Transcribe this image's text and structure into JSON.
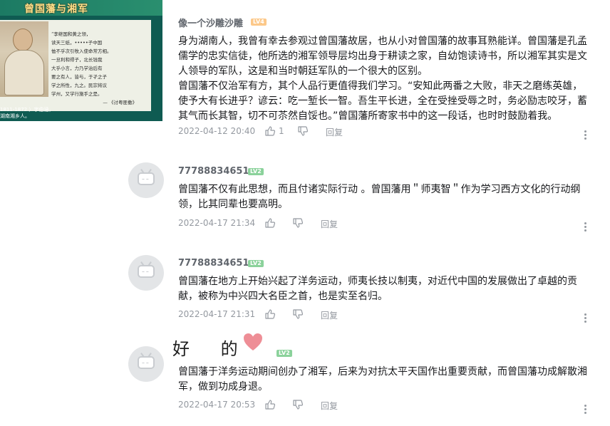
{
  "video": {
    "title": "曾国藩与湘军",
    "poem_lines": [
      "“李继国和黄之领，",
      "读天三纸，•••••子中国",
      "恤不乎次引牧入使命常方相。",
      "一旦利和得子，北长钱我",
      "大乎小言，力乃学治后有",
      "要之有人，皆与，于孑之子",
      "学之所性，九之。民宗将议",
      "学州，又学行施手之是。",
      "— 《讨粤匪檄》"
    ],
    "dates": [
      "1811-1872 ）字伯涵，",
      "湖南湘乡人。"
    ]
  },
  "comments": [
    {
      "username": "像一个沙雕沙雕",
      "level": "LV4",
      "paragraphs": [
        "身为湖南人，我曾有幸去参观过曾国藩故居，也从小对曾国藩的故事耳熟能详。曾国藩是孔孟儒学的忠实信徒，他所选的湘军领导层均出身于耕读之家，自幼饱读诗书，所以湘军其实是文人领导的军队，这是和当时朝廷军队的一个很大的区别。",
        "曾国藩不仅治军有方，其个人品行更值得我们学习。“安知此两番之大败，非天之磨练英雄，使予大有长进乎？谚云：吃一堑长一智。吾生平长进，全在受挫受辱之时，务必励志咬牙，蓄其气而长其智，切不可苶然自馁也。”曾国藩所寄家书中的这一段话，也时时鼓励着我。"
      ],
      "date": "2022-04-12 20:40",
      "likes": "1",
      "reply_label": "回复"
    },
    {
      "username": "77788834651",
      "level": "LV2",
      "paragraphs": [
        "曾国藩不仅有此思想，而且付诸实际行动 。曾国藩用＂师夷智＂作为学习西方文化的行动纲领，比其同辈也要高明。"
      ],
      "date": "2022-04-17 21:34",
      "likes": "",
      "reply_label": "回复"
    },
    {
      "username": "77788834651",
      "level": "LV2",
      "paragraphs": [
        "曾国藩在地方上开始兴起了洋务运动，师夷长技以制夷，对近代中国的发展做出了卓越的贡献，被称为中兴四大名臣之首，也是实至名归。"
      ],
      "date": "2022-04-17 21:31",
      "likes": "",
      "reply_label": "回复"
    },
    {
      "username_decoration": "好 的",
      "level": "LV2",
      "paragraphs": [
        "曾国藩于洋务运动期间创办了湘军，后来为对抗太平天国作出重要贡献，而曾国藩功成解散湘军，做到功成身退。"
      ],
      "date": "2022-04-17 20:53",
      "likes": "",
      "reply_label": "回复"
    }
  ],
  "colors": {
    "meta": "#9499a0",
    "username": "#61666d",
    "lv2": "#8bd29b",
    "lv4": "#fcc889",
    "heart": "#ee8e96"
  },
  "icons": [
    "like-icon",
    "dislike-icon",
    "more-icon",
    "tv-avatar-icon",
    "heart-icon"
  ]
}
